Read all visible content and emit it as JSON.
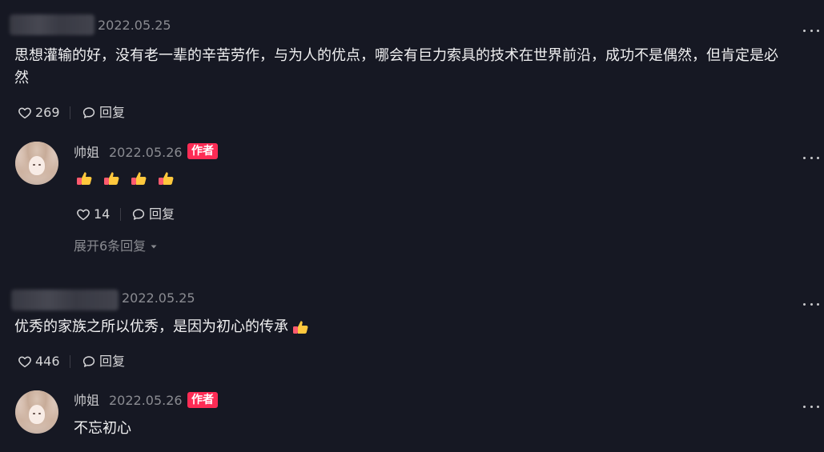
{
  "comments": [
    {
      "date": "2022.05.25",
      "text_line1": "思想灌输的好，没有老一辈的辛苦劳作，与为人的优点，哪会有巨力索具的技术在世界前沿，成功不是偶然，但肯定是必",
      "text_line2": "然",
      "likes": "269",
      "reply_label": "回复",
      "reply": {
        "author": "帅姐",
        "date": "2022.05.26",
        "badge": "作者",
        "text": "👍👍👍👍",
        "likes": "14",
        "reply_label": "回复"
      },
      "expand_label": "展开6条回复"
    },
    {
      "date": "2022.05.25",
      "text": "优秀的家族之所以优秀，是因为初心的传承",
      "likes": "446",
      "reply_label": "回复",
      "reply": {
        "author": "帅姐",
        "date": "2022.05.26",
        "badge": "作者",
        "text": "不忘初心"
      }
    }
  ],
  "icons": {
    "like": "heart-outline-icon",
    "reply": "speech-bubble-icon",
    "more": "more-dots-icon",
    "expand": "caret-down-icon",
    "emoji": "thumbs-up-emoji"
  },
  "colors": {
    "background": "#161823",
    "author_badge": "#fe2c55",
    "muted_text": "#8a8b91"
  }
}
